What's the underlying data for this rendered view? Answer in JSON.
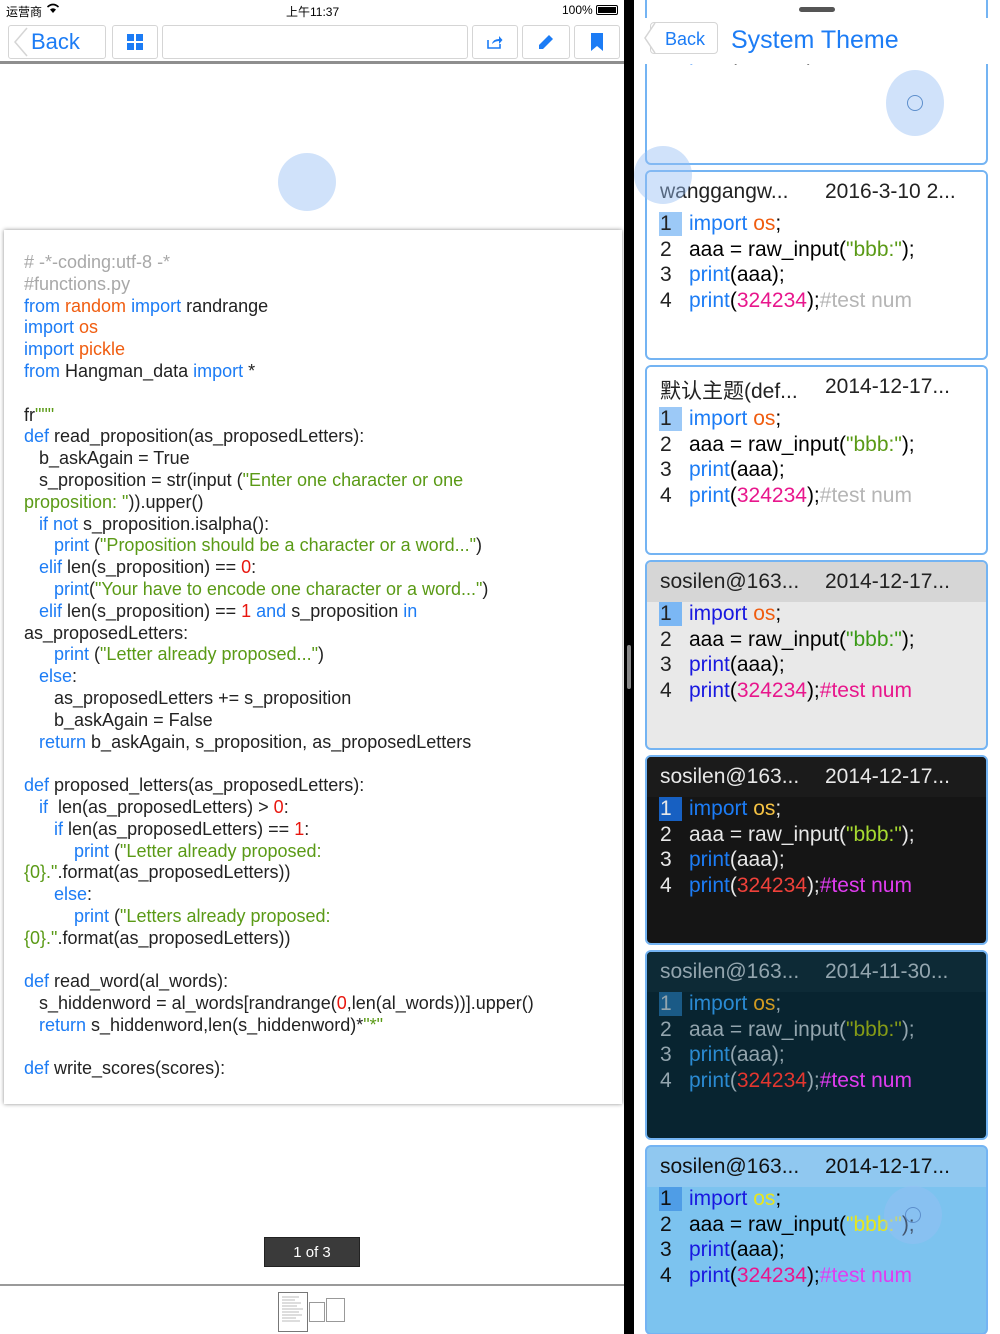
{
  "status_bar": {
    "carrier": "运营商",
    "time": "上午11:37",
    "battery": "100%"
  },
  "toolbar": {
    "back_label": "Back",
    "search_value": ""
  },
  "code_lines": [
    [
      [
        "c-com",
        "# -*-coding:utf-8 -*"
      ]
    ],
    [
      [
        "c-com",
        "#functions.py"
      ]
    ],
    [
      [
        "c-kw",
        "from "
      ],
      [
        "c-mod",
        "random "
      ],
      [
        "c-kw",
        "import "
      ],
      [
        "",
        "randrange"
      ]
    ],
    [
      [
        "c-kw",
        "import "
      ],
      [
        "c-mod",
        "os"
      ]
    ],
    [
      [
        "c-kw",
        "import "
      ],
      [
        "c-mod",
        "pickle"
      ]
    ],
    [
      [
        "c-kw",
        "from "
      ],
      [
        "",
        "Hangman_data "
      ],
      [
        "c-kw",
        "import "
      ],
      [
        "",
        "*"
      ]
    ],
    [
      [
        "",
        ""
      ]
    ],
    [
      [
        "",
        "fr"
      ],
      [
        "c-str",
        "\"\"\""
      ]
    ],
    [
      [
        "c-kw",
        "def "
      ],
      [
        "",
        "read_proposition(as_proposedLetters):"
      ]
    ],
    [
      [
        "",
        "   b_askAgain = True"
      ]
    ],
    [
      [
        "",
        "   s_proposition = str(input ("
      ],
      [
        "c-str",
        "\"Enter one character or one"
      ]
    ],
    [
      [
        "c-str",
        "proposition: \""
      ],
      [
        "",
        "))."
      ],
      [
        "",
        "upper()"
      ]
    ],
    [
      [
        "c-kw",
        "   if not "
      ],
      [
        "",
        "s_proposition.isalpha():"
      ]
    ],
    [
      [
        "c-kw",
        "      print "
      ],
      [
        "",
        "("
      ],
      [
        "c-str",
        "\"Proposition should be a character or a word...\""
      ],
      [
        "",
        ")"
      ]
    ],
    [
      [
        "c-kw",
        "   elif "
      ],
      [
        "",
        "len(s_proposition) == "
      ],
      [
        "c-num",
        "0"
      ],
      [
        "",
        ":"
      ]
    ],
    [
      [
        "c-kw",
        "      print"
      ],
      [
        "",
        "("
      ],
      [
        "c-str",
        "\"Your have to encode one character or a word...\""
      ],
      [
        "",
        ")"
      ]
    ],
    [
      [
        "c-kw",
        "   elif "
      ],
      [
        "",
        "len(s_proposition) == "
      ],
      [
        "c-num",
        "1 "
      ],
      [
        "c-kw",
        "and "
      ],
      [
        "",
        "s_proposition "
      ],
      [
        "c-kw",
        "in"
      ]
    ],
    [
      [
        "",
        "as_proposedLetters:"
      ]
    ],
    [
      [
        "c-kw",
        "      print "
      ],
      [
        "",
        "("
      ],
      [
        "c-str",
        "\"Letter already proposed...\""
      ],
      [
        "",
        ")"
      ]
    ],
    [
      [
        "c-kw",
        "   else"
      ],
      [
        "",
        ":"
      ]
    ],
    [
      [
        "",
        "      as_proposedLetters += s_proposition"
      ]
    ],
    [
      [
        "",
        "      b_askAgain = False"
      ]
    ],
    [
      [
        "c-kw",
        "   return "
      ],
      [
        "",
        "b_askAgain, s_proposition, as_proposedLetters"
      ]
    ],
    [
      [
        "",
        ""
      ]
    ],
    [
      [
        "c-kw",
        "def "
      ],
      [
        "",
        "proposed_letters(as_proposedLetters):"
      ]
    ],
    [
      [
        "c-kw",
        "   if  "
      ],
      [
        "",
        "len(as_proposedLetters) > "
      ],
      [
        "c-num",
        "0"
      ],
      [
        "",
        ":"
      ]
    ],
    [
      [
        "c-kw",
        "      if "
      ],
      [
        "",
        "len(as_proposedLetters) == "
      ],
      [
        "c-num",
        "1"
      ],
      [
        "",
        ":"
      ]
    ],
    [
      [
        "c-kw",
        "          print "
      ],
      [
        "",
        "("
      ],
      [
        "c-str",
        "\"Letter already proposed:"
      ]
    ],
    [
      [
        "c-str",
        "{0}.\""
      ],
      [
        "",
        ".format(as_proposedLetters))"
      ]
    ],
    [
      [
        "c-kw",
        "      else"
      ],
      [
        "",
        ":"
      ]
    ],
    [
      [
        "c-kw",
        "          print "
      ],
      [
        "",
        "("
      ],
      [
        "c-str",
        "\"Letters already proposed:"
      ]
    ],
    [
      [
        "c-str",
        "{0}.\""
      ],
      [
        "",
        ".format(as_proposedLetters))"
      ]
    ],
    [
      [
        "",
        ""
      ]
    ],
    [
      [
        "c-kw",
        "def "
      ],
      [
        "",
        "read_word(al_words):"
      ]
    ],
    [
      [
        "",
        "   s_hiddenword = al_words[randrange("
      ],
      [
        "c-num",
        "0"
      ],
      [
        "",
        ",len(al_words))].upper()"
      ]
    ],
    [
      [
        "c-kw",
        "   return "
      ],
      [
        "",
        "s_hiddenword,len(s_hiddenword)*"
      ],
      [
        "c-str",
        "\"*\""
      ]
    ],
    [
      [
        "",
        ""
      ]
    ],
    [
      [
        "c-kw",
        "def "
      ],
      [
        "",
        "write_scores(scores):"
      ]
    ]
  ],
  "page_indicator": "1 of 3",
  "right_header": {
    "back_label": "Back",
    "title": "System Theme"
  },
  "card_code": {
    "l1": [
      "import",
      " os",
      ";"
    ],
    "l2": [
      "aaa = raw_input(",
      "\"bbb:\"",
      ");"
    ],
    "l3": [
      "print",
      "(aaa);"
    ],
    "l4": [
      "print",
      "(",
      "324234",
      ");",
      "#test num"
    ]
  },
  "themes": [
    {
      "name": "",
      "date": "",
      "head_bg": "#ffffff",
      "bg": "#ffffff",
      "plain": "#000000",
      "kw": "#1c7cf5",
      "mod": "#f05d10",
      "str": "#5a9a16",
      "num": "#e8168c",
      "com": "#b5b5b5",
      "lineno": "#222222",
      "sel": "#9cc9f7",
      "head_color": "#222222"
    },
    {
      "name": "wanggangw...",
      "date": "2016-3-10 2...",
      "head_bg": "#ffffff",
      "bg": "#ffffff",
      "plain": "#000000",
      "kw": "#1c7cf5",
      "mod": "#f05d10",
      "str": "#5a9a16",
      "num": "#e8168c",
      "com": "#b5b5b5",
      "lineno": "#222222",
      "sel": "#9cc9f7",
      "head_color": "#222222"
    },
    {
      "name": "默认主题(def...",
      "date": "2014-12-17...",
      "head_bg": "#ffffff",
      "bg": "#ffffff",
      "plain": "#000000",
      "kw": "#1c7cf5",
      "mod": "#f05d10",
      "str": "#5a9a16",
      "num": "#e8168c",
      "com": "#b5b5b5",
      "lineno": "#222222",
      "sel": "#9cc9f7",
      "head_color": "#222222"
    },
    {
      "name": "sosilen@163...",
      "date": "2014-12-17...",
      "head_bg": "#d6d6d6",
      "bg": "#e9e9e9",
      "plain": "#000000",
      "kw": "#1818e0",
      "mod": "#f05d10",
      "str": "#3a9a16",
      "num": "#e8168c",
      "com": "#e8168c",
      "lineno": "#222222",
      "sel": "#7bb7f4",
      "head_color": "#222222"
    },
    {
      "name": "sosilen@163...",
      "date": "2014-12-17...",
      "head_bg": "#1b1b1b",
      "bg": "#151515",
      "plain": "#e8e8e8",
      "kw": "#1c7cf5",
      "mod": "#f5c243",
      "str": "#a6d930",
      "num": "#f0413a",
      "com": "#e03cf0",
      "lineno": "#e8e8e8",
      "sel": "#1760c2",
      "head_color": "#e8e8e8"
    },
    {
      "name": "sosilen@163...",
      "date": "2014-11-30...",
      "head_bg": "#0d2a36",
      "bg": "#082430",
      "plain": "#93a5ae",
      "kw": "#2a8ad2",
      "mod": "#cf9a21",
      "str": "#859b16",
      "num": "#e3362f",
      "com": "#e03cf0",
      "lineno": "#93a5ae",
      "sel": "#1a5a86",
      "head_color": "#93a5ae"
    },
    {
      "name": "sosilen@163...",
      "date": "2014-12-17...",
      "head_bg": "#90c8f0",
      "bg": "#7cc3ef",
      "plain": "#000000",
      "kw": "#1818e0",
      "mod": "#e8e61c",
      "str": "#e8e61c",
      "num": "#e8168c",
      "com": "#e03cf0",
      "lineno": "#111111",
      "sel": "#4f9de6",
      "head_color": "#111111"
    }
  ],
  "colors": {
    "accent": "#1c7cf5",
    "card_border": "#74b4f3"
  }
}
